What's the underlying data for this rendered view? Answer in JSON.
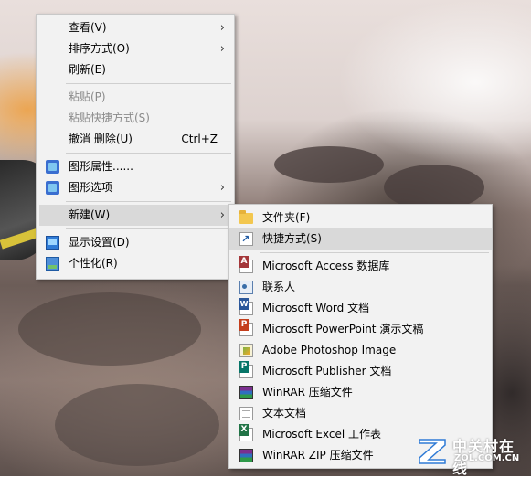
{
  "context_menu": {
    "items": [
      {
        "label": "查看(V)",
        "submenu": true
      },
      {
        "label": "排序方式(O)",
        "submenu": true
      },
      {
        "label": "刷新(E)"
      },
      {
        "label": "粘贴(P)",
        "disabled": true
      },
      {
        "label": "粘贴快捷方式(S)",
        "disabled": true
      },
      {
        "label": "撤消 删除(U)",
        "shortcut": "Ctrl+Z"
      },
      {
        "label": "图形属性......",
        "icon": "graphics-properties-icon"
      },
      {
        "label": "图形选项",
        "icon": "graphics-options-icon",
        "submenu": true
      },
      {
        "label": "新建(W)",
        "submenu": true,
        "highlighted": true
      },
      {
        "label": "显示设置(D)",
        "icon": "display-settings-icon"
      },
      {
        "label": "个性化(R)",
        "icon": "personalize-icon"
      }
    ],
    "submenu_arrow": "›"
  },
  "new_submenu": {
    "items": [
      {
        "label": "文件夹(F)",
        "icon": "folder-icon"
      },
      {
        "label": "快捷方式(S)",
        "icon": "shortcut-icon",
        "highlighted": true
      },
      {
        "label": "Microsoft Access 数据库",
        "icon": "access-icon"
      },
      {
        "label": "联系人",
        "icon": "contact-icon"
      },
      {
        "label": "Microsoft Word 文档",
        "icon": "word-icon"
      },
      {
        "label": "Microsoft PowerPoint 演示文稿",
        "icon": "powerpoint-icon"
      },
      {
        "label": "Adobe Photoshop Image",
        "icon": "photoshop-icon"
      },
      {
        "label": "Microsoft Publisher 文档",
        "icon": "publisher-icon"
      },
      {
        "label": "WinRAR 压缩文件",
        "icon": "winrar-icon"
      },
      {
        "label": "文本文档",
        "icon": "text-document-icon"
      },
      {
        "label": "Microsoft Excel 工作表",
        "icon": "excel-icon"
      },
      {
        "label": "WinRAR ZIP 压缩文件",
        "icon": "winrar-zip-icon"
      }
    ]
  },
  "watermark": {
    "brand_cn": "中关村在线",
    "brand_en": "ZOL.COM.CN"
  },
  "colors": {
    "menu_bg": "#f2f2f2",
    "hover_bg": "#d9d9d9",
    "disabled_text": "#8a8a8a"
  }
}
